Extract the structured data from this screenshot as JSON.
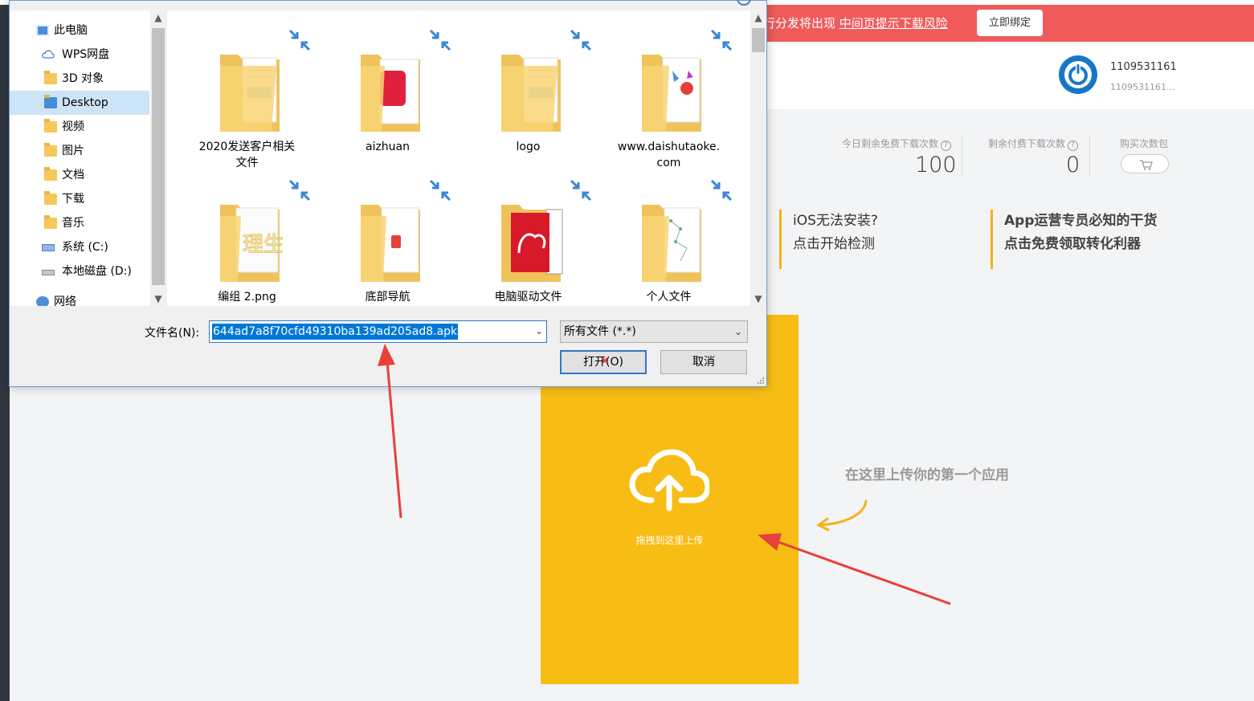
{
  "banner": {
    "text_prefix": "行分发将出现 ",
    "text_link": "中间页提示下载风险",
    "bind_button": "立即绑定"
  },
  "user": {
    "name": "1109531161",
    "id": "1109531161..."
  },
  "stats": {
    "free_label": "今日剩余免费下载次数",
    "free_value": "100",
    "paid_label": "剩余付费下载次数",
    "paid_value": "0",
    "buy_label": "购买次数包"
  },
  "promos": [
    {
      "line1": "iOS无法安装?",
      "line2": "点击开始检测"
    },
    {
      "line1": "App运营专员必知的干货",
      "line2": "点击免费领取转化利器"
    }
  ],
  "upload": {
    "label": "拖拽到这里上传",
    "hint": "在这里上传你的第一个应用"
  },
  "dialog": {
    "nav_items": [
      {
        "label": "此电脑",
        "icon": "computer-icon"
      },
      {
        "label": "WPS网盘",
        "icon": "cloud-icon"
      },
      {
        "label": "3D 对象",
        "icon": "folder-icon"
      },
      {
        "label": "Desktop",
        "icon": "folder-icon",
        "selected": true
      },
      {
        "label": "视频",
        "icon": "folder-icon"
      },
      {
        "label": "图片",
        "icon": "folder-icon"
      },
      {
        "label": "文档",
        "icon": "folder-icon"
      },
      {
        "label": "下载",
        "icon": "download-folder-icon"
      },
      {
        "label": "音乐",
        "icon": "music-folder-icon"
      },
      {
        "label": "系统 (C:)",
        "icon": "drive-icon"
      },
      {
        "label": "本地磁盘 (D:)",
        "icon": "drive-icon"
      },
      {
        "label": "网络",
        "icon": "network-icon"
      }
    ],
    "files": [
      {
        "name": "2020发送客户相关\n文件",
        "thumb": "doc"
      },
      {
        "name": "aizhuan",
        "thumb": "red-app"
      },
      {
        "name": "logo",
        "thumb": "doc"
      },
      {
        "name": "www.daishutaoke.\ncom",
        "thumb": "colorful"
      },
      {
        "name": "编组 2.png",
        "thumb": "text"
      },
      {
        "name": "底部导航",
        "thumb": "red-small"
      },
      {
        "name": "电脑驱动文件",
        "thumb": "adobe"
      },
      {
        "name": "个人文件",
        "thumb": "diagram"
      }
    ],
    "filename_label": "文件名(N):",
    "filename_value": "644ad7a8f70cfd49310ba139ad205ad8.apk",
    "filetype_value": "所有文件 (*.*)",
    "open_button": "打开(O)",
    "cancel_button": "取消"
  },
  "colors": {
    "banner_bg": "#ef5b5b",
    "upload_bg": "#f8bd14",
    "promo_accent": "#f5b21a",
    "selection_blue": "#0078d7",
    "annotation_red": "#e8403a"
  }
}
